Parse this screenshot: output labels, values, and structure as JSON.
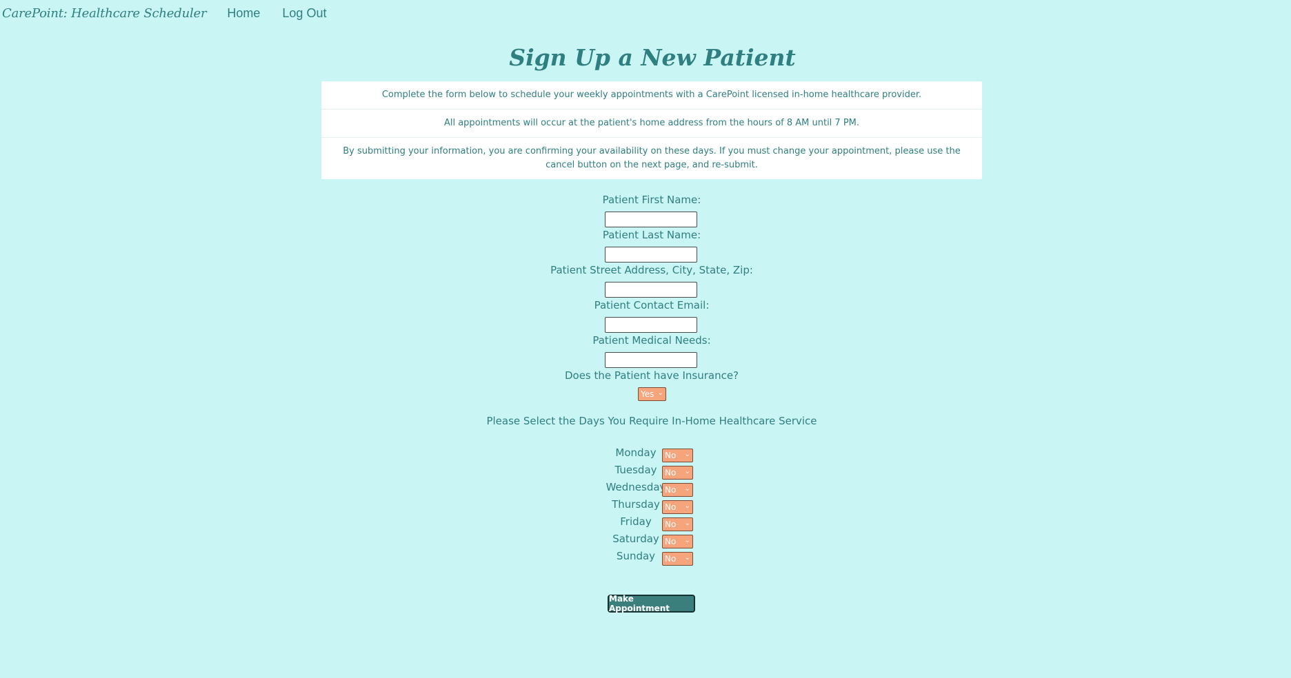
{
  "nav": {
    "brand": "CarePoint: Healthcare Scheduler",
    "links": [
      "Home",
      "Log Out"
    ]
  },
  "page": {
    "title": "Sign Up a New Patient",
    "info": [
      "Complete the form below to schedule your weekly appointments with a CarePoint licensed in-home healthcare provider.",
      "All appointments will occur at the patient's home address from the hours of 8 AM until 7 PM.",
      "By submitting your information, you are confirming your availability on these days. If you must change your appointment, please use the cancel button on the next page, and re-submit."
    ]
  },
  "form": {
    "first_name_label": "Patient First Name:",
    "last_name_label": "Patient Last Name:",
    "address_label": "Patient Street Address, City, State, Zip:",
    "email_label": "Patient Contact Email:",
    "medical_needs_label": "Patient Medical Needs:",
    "insurance_label": "Does the Patient have Insurance?",
    "insurance_value": "Yes",
    "days_heading": "Please Select the Days You Require In-Home Healthcare Service",
    "days": [
      {
        "day": "Monday",
        "value": "No"
      },
      {
        "day": "Tuesday",
        "value": "No"
      },
      {
        "day": "Wednesday",
        "value": "No"
      },
      {
        "day": "Thursday",
        "value": "No"
      },
      {
        "day": "Friday",
        "value": "No"
      },
      {
        "day": "Saturday",
        "value": "No"
      },
      {
        "day": "Sunday",
        "value": "No"
      }
    ],
    "submit_label": "Make Appointment"
  },
  "colors": {
    "background": "#c9f5f4",
    "text": "#2f7f80",
    "select_bg": "#f5a47b",
    "button_bg": "#3b7f7c"
  }
}
